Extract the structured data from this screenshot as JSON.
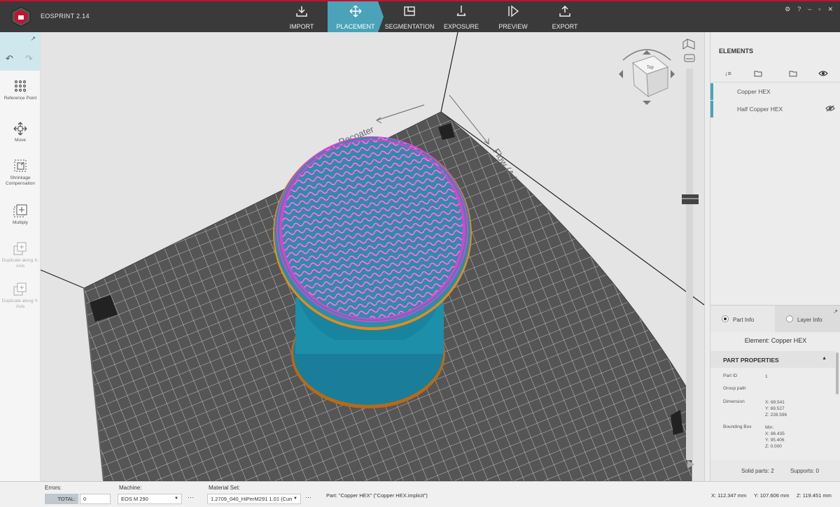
{
  "app": {
    "title": "EOSPRINT 2.14"
  },
  "nav": {
    "tabs": [
      {
        "id": "import",
        "label": "IMPORT",
        "icon": "download-icon"
      },
      {
        "id": "placement",
        "label": "PLACEMENT",
        "icon": "move-arrows-icon",
        "active": true
      },
      {
        "id": "segmentation",
        "label": "SEGMENTATION",
        "icon": "segmentation-icon"
      },
      {
        "id": "exposure",
        "label": "EXPOSURE",
        "icon": "exposure-icon"
      },
      {
        "id": "preview",
        "label": "PREVIEW",
        "icon": "play-icon"
      },
      {
        "id": "export",
        "label": "EXPORT",
        "icon": "upload-icon"
      }
    ]
  },
  "window_controls": {
    "settings": "⚙",
    "help": "?",
    "minimize": "–",
    "restore": "▫",
    "close": "✕"
  },
  "tools": [
    {
      "id": "reference-point",
      "label": "Reference Point",
      "disabled": false
    },
    {
      "id": "move",
      "label": "Move",
      "disabled": false
    },
    {
      "id": "shrinkage",
      "label": "Shrinkage Compensation",
      "disabled": false
    },
    {
      "id": "multiply",
      "label": "Multiply",
      "disabled": false
    },
    {
      "id": "duplicate-x",
      "label": "Duplicate along X-Axis",
      "disabled": true
    },
    {
      "id": "duplicate-y",
      "label": "Duplicate along Y-Axis",
      "disabled": true
    }
  ],
  "viewport": {
    "recoater_label": "Recoater",
    "flow_label": "Flow (Ar)",
    "view_cube_face": "Top"
  },
  "elements_panel": {
    "title": "ELEMENTS",
    "items": [
      {
        "name": "Copper HEX",
        "hidden": false
      },
      {
        "name": "Half Copper HEX",
        "hidden": true
      }
    ]
  },
  "info": {
    "tabs": [
      {
        "label": "Part Info",
        "selected": true
      },
      {
        "label": "Layer Info",
        "selected": false
      }
    ],
    "element_name": "Element: Copper HEX",
    "section_title": "PART PROPERTIES",
    "part_id_label": "Part ID",
    "part_id": "1",
    "group_path_label": "Group path",
    "dimension_label": "Dimension",
    "dimension": {
      "x": "X: 69.541",
      "y": "Y: 69.527",
      "z": "Z: 228.596"
    },
    "bbox_label": "Bounding Box",
    "bbox": {
      "min": "Min:",
      "x": "X: 86.435",
      "y": "Y: 95.406",
      "z": "Z: 0.000"
    },
    "solid_parts": "Solid parts: 2",
    "supports": "Supports: 0"
  },
  "bottom": {
    "errors_label": "Errors:",
    "total_label": "TOTAL:",
    "total_value": "0",
    "machine_label": "Machine:",
    "machine_value": "EOS M 290",
    "material_label": "Material Set:",
    "material_value": "1.2709_040_HiPerM291 1.01 (Cun",
    "more": "···",
    "part_text": "Part: \"Copper HEX\" (\"Copper HEX.implicit\")",
    "coord_x": "X: 112.347 mm",
    "coord_y": "Y: 107.606 mm",
    "coord_z": "Z: 119.451 mm"
  },
  "colors": {
    "accent": "#4aa3b8",
    "brand_red": "#c8102e",
    "part_teal": "#1a7d99",
    "lattice_pink": "#e040d0",
    "outline_orange": "#e38a1d"
  }
}
